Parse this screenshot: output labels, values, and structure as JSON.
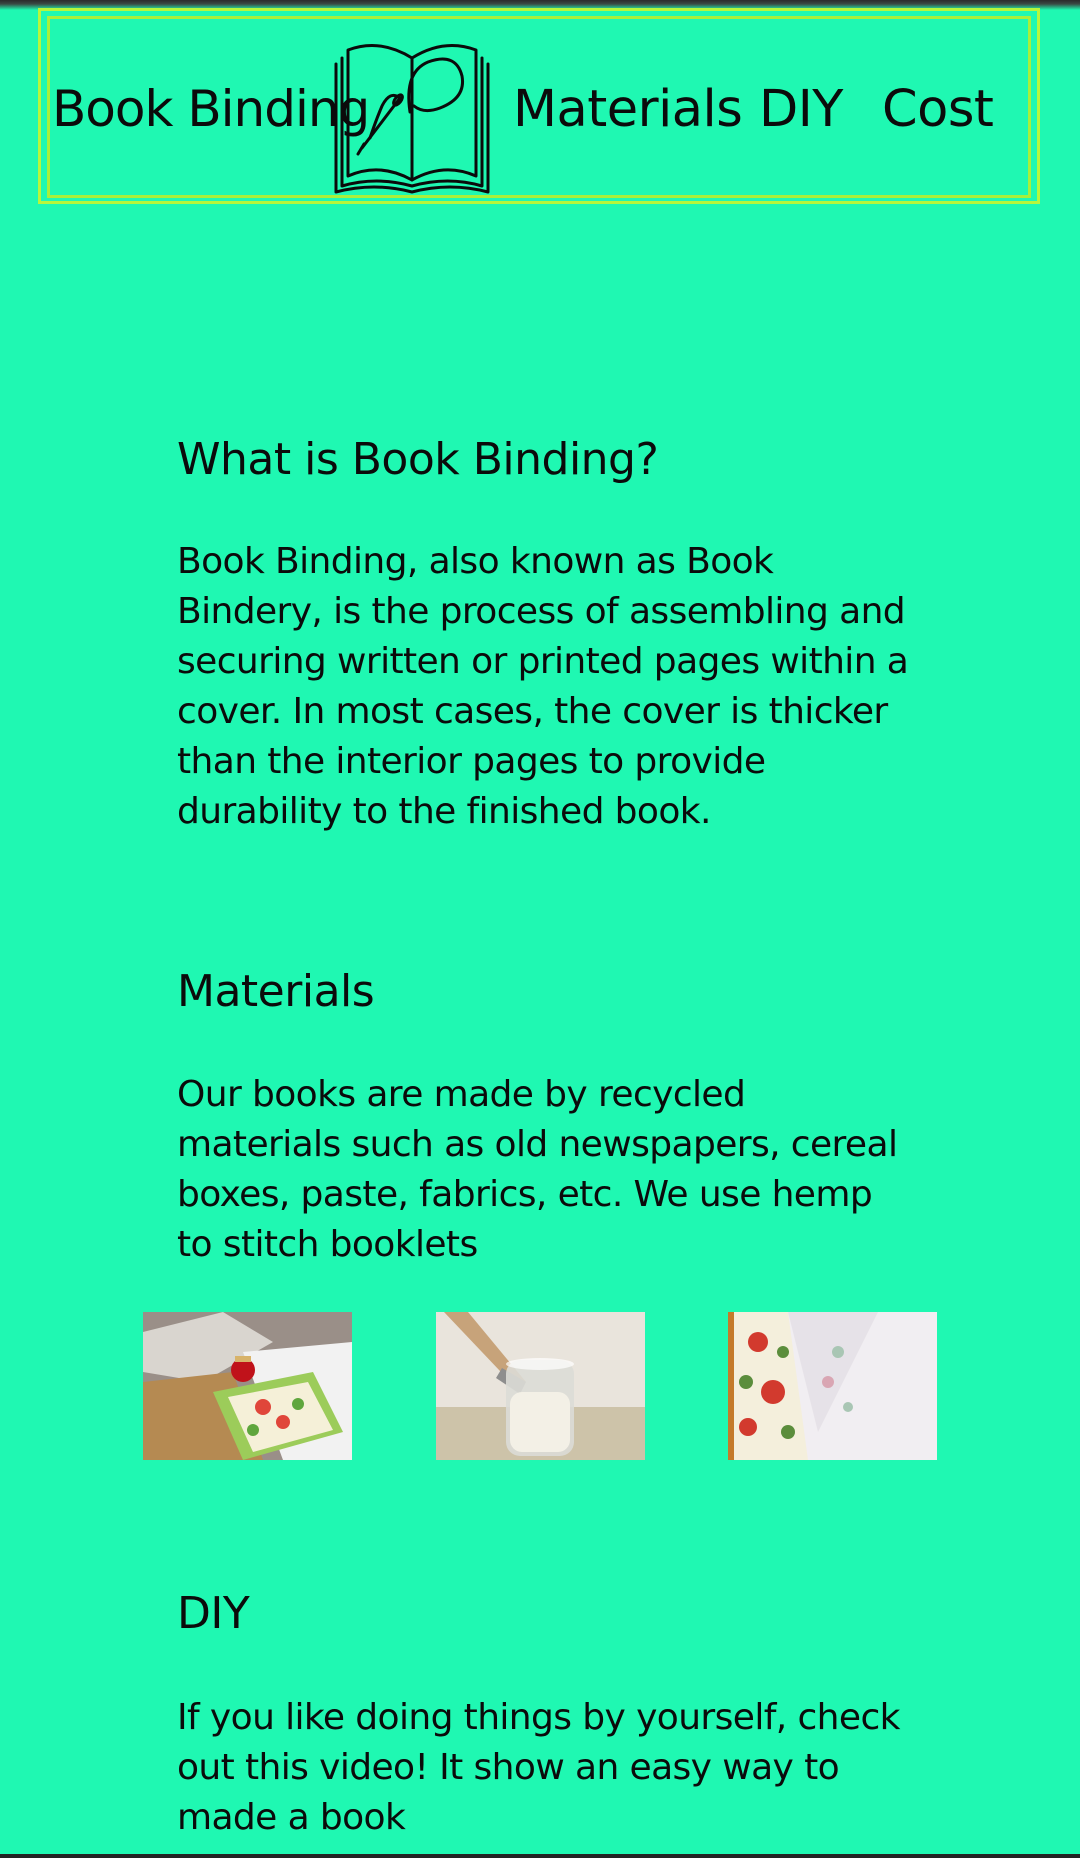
{
  "nav": {
    "brand": "Book Binding",
    "logo_icon": "book-needle-thread-icon",
    "links": [
      "Materials",
      "DIY",
      "Cost"
    ]
  },
  "sections": {
    "what": {
      "heading": "What is Book Binding?",
      "text": "Book Binding, also known as Book Bindery, is the process of assembling and securing written or printed pages within a cover. In most cases, the cover is thicker than the interior pages to provide durability to the finished book."
    },
    "materials": {
      "heading": "Materials",
      "text": "Our books are made by recycled materials such as old newspapers, cereal boxes, paste, fabrics, etc. We use hemp to stitch booklets",
      "photos": [
        "recycled-papers-and-boxes-photo",
        "paste-jar-with-brush-photo",
        "floral-fabric-and-paper-photo"
      ]
    },
    "diy": {
      "heading": "DIY",
      "text": "If you like doing things by yourself, check out this video! It show an easy way to made a book"
    }
  },
  "colors": {
    "background": "#1ff8b2",
    "frame": "#b7f63c",
    "text": "#0b0b0b"
  }
}
